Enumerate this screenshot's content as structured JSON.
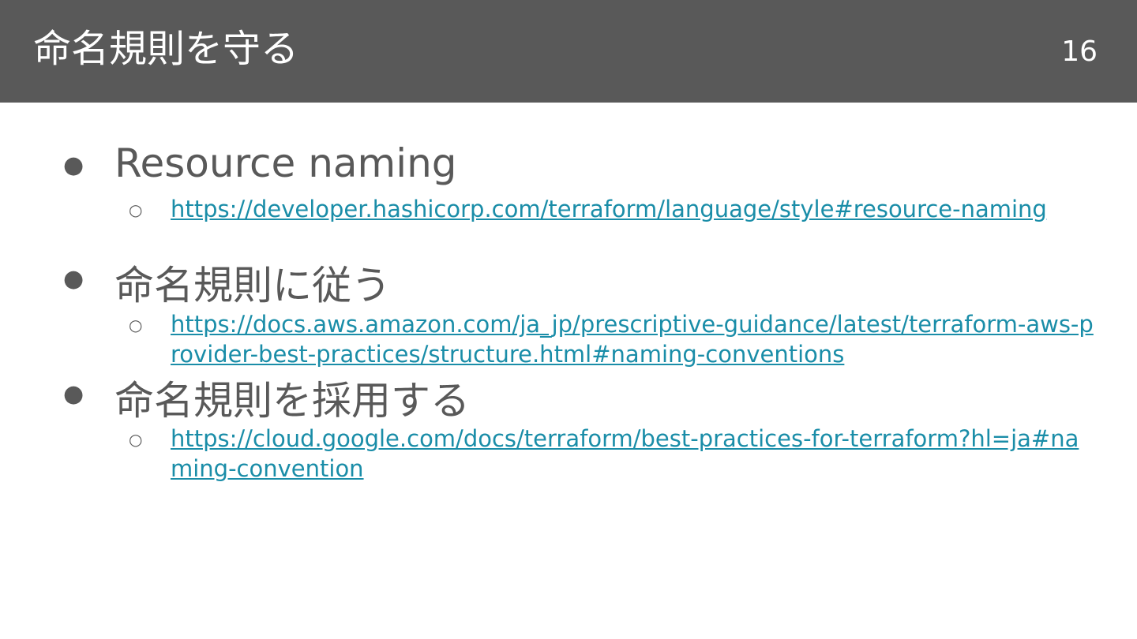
{
  "slide": {
    "title": "命名規則を守る",
    "page_number": "16"
  },
  "bullets": [
    {
      "text": "Resource naming",
      "marker": "●",
      "sub": {
        "marker": "○",
        "link": "https://developer.hashicorp.com/terraform/language/style#resource-naming"
      }
    },
    {
      "text": "命名規則に従う",
      "marker": "●",
      "sub": {
        "marker": "○",
        "link": "https://docs.aws.amazon.com/ja_jp/prescriptive-guidance/latest/terraform-aws-provider-best-practices/structure.html#naming-conventions"
      }
    },
    {
      "text": "命名規則を採用する",
      "marker": "●",
      "sub": {
        "marker": "○",
        "link": "https://cloud.google.com/docs/terraform/best-practices-for-terraform?hl=ja#naming-convention"
      }
    }
  ],
  "colors": {
    "header_bg": "#595959",
    "link": "#1a8da8",
    "text": "#595959"
  }
}
